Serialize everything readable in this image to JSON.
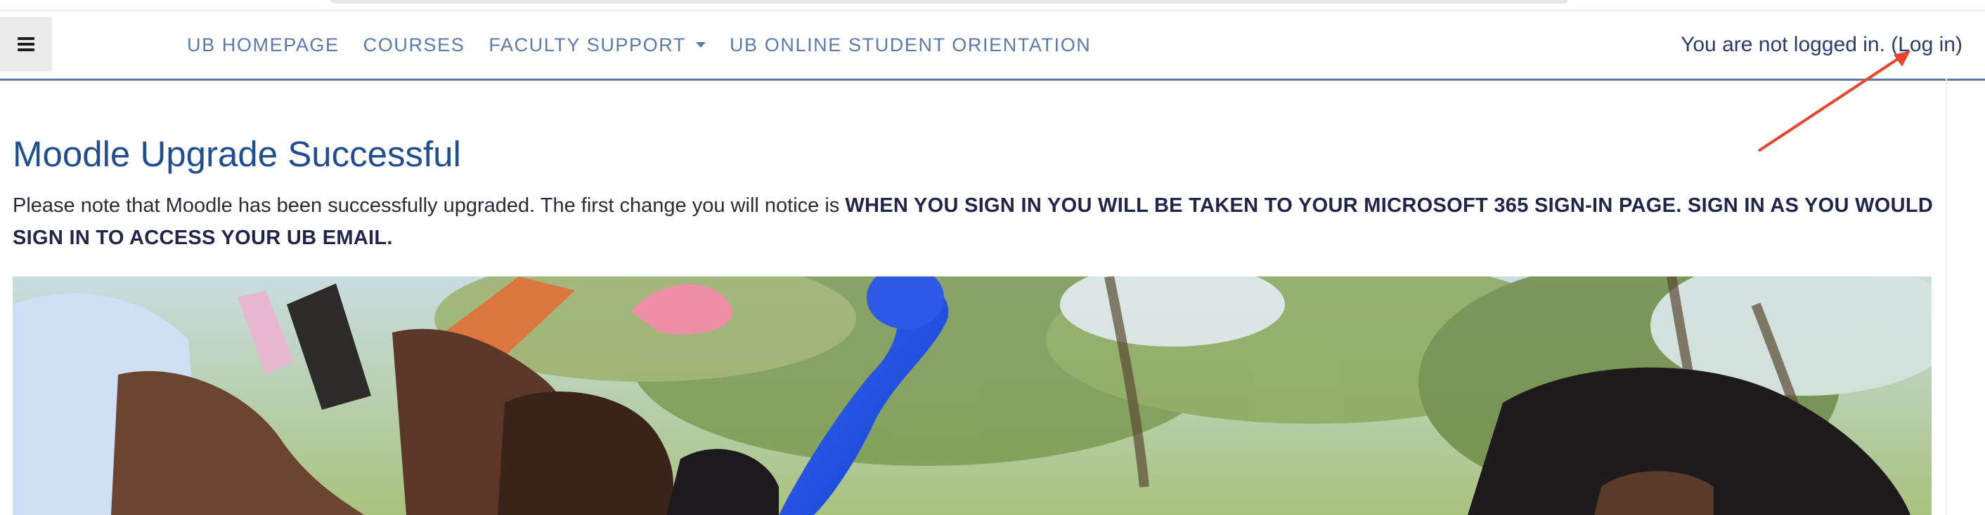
{
  "navbar": {
    "menu_icon": "hamburger-menu-icon",
    "links": [
      {
        "label": "UB HOMEPAGE"
      },
      {
        "label": "COURSES"
      },
      {
        "label": "FACULTY SUPPORT",
        "has_dropdown": true
      },
      {
        "label": "UB ONLINE STUDENT ORIENTATION"
      }
    ],
    "login_status": {
      "prefix": "You are not logged in. (",
      "link_label": "Log in",
      "suffix": ")"
    }
  },
  "main": {
    "title": "Moodle Upgrade Successful",
    "notice_plain": "Please note that Moodle has been successfully upgraded. The first change you will notice is ",
    "notice_bold": "WHEN YOU SIGN IN YOU WILL BE TAKEN TO YOUR MICROSOFT 365 SIGN-IN PAGE. SIGN IN AS YOU WOULD SIGN IN TO ACCESS YOUR UB EMAIL."
  },
  "annotation": {
    "arrow_color": "#e8432b"
  },
  "colors": {
    "nav_link": "#5a79ac",
    "title": "#1f4f91",
    "nav_border": "#5b76a3"
  }
}
